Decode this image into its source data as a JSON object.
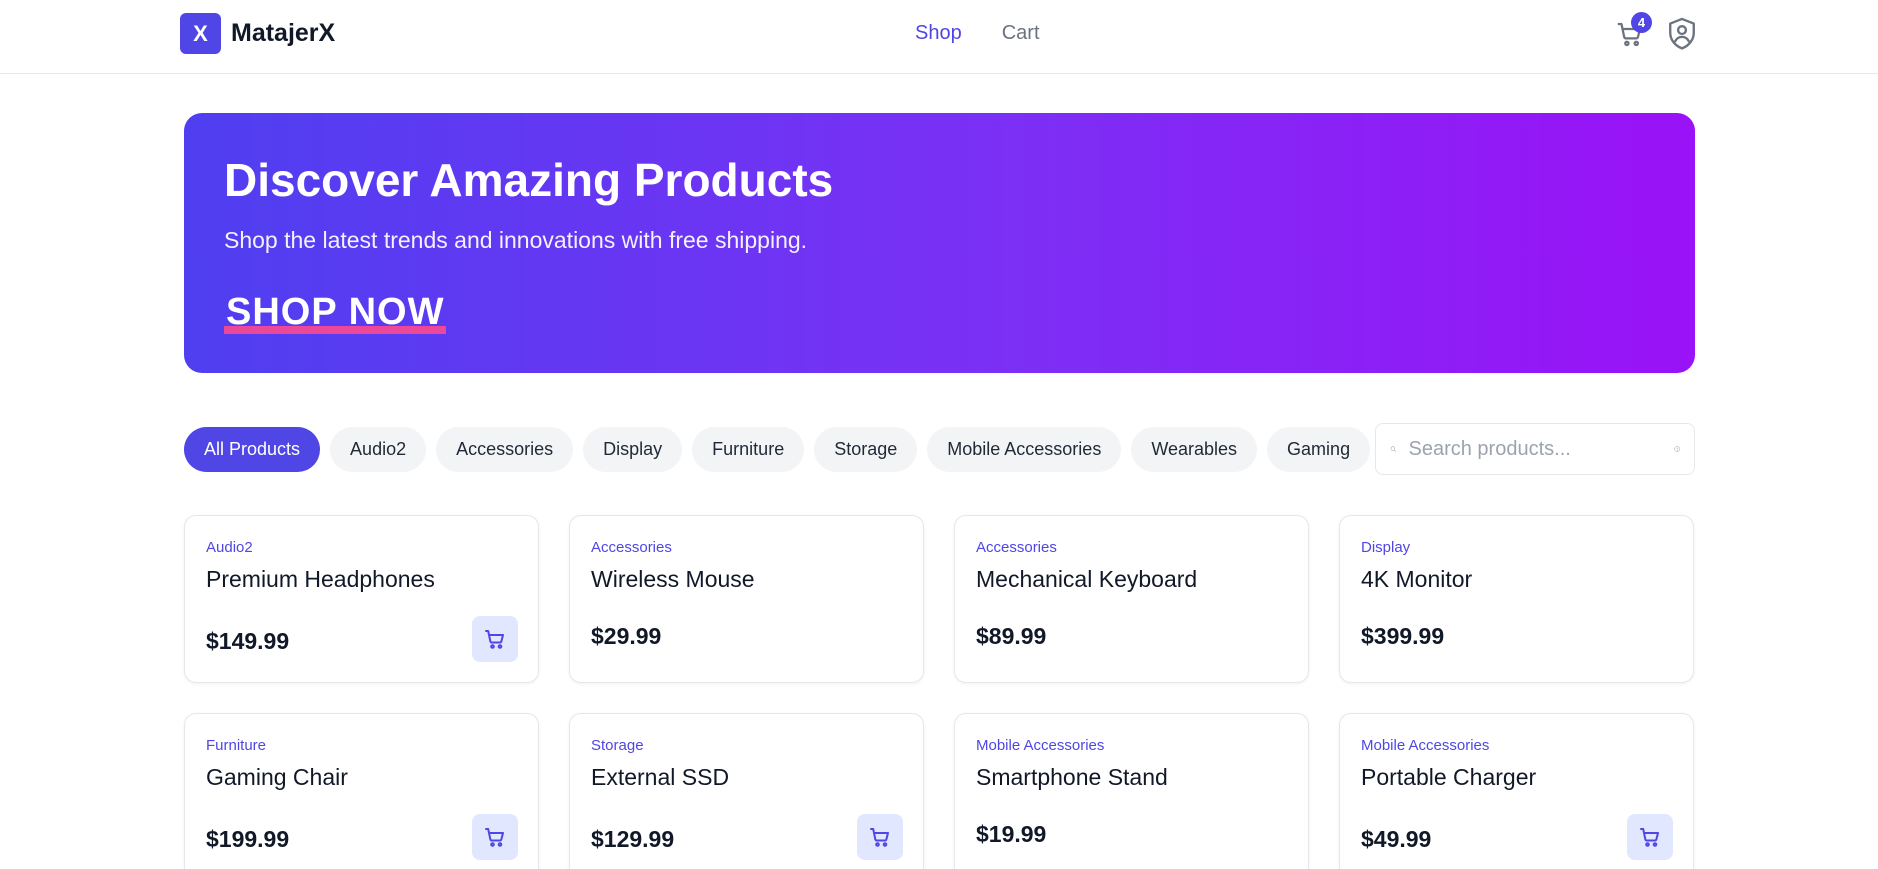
{
  "brand": {
    "logo_letter": "X",
    "name": "MatajerX"
  },
  "nav": {
    "shop": "Shop",
    "cart": "Cart"
  },
  "header": {
    "cart_count": "4"
  },
  "hero": {
    "title": "Discover Amazing Products",
    "subtitle": "Shop the latest trends and innovations with free shipping.",
    "cta": "SHOP NOW"
  },
  "filters": [
    "All Products",
    "Audio2",
    "Accessories",
    "Display",
    "Furniture",
    "Storage",
    "Mobile Accessories",
    "Wearables",
    "Gaming"
  ],
  "search": {
    "placeholder": "Search products..."
  },
  "products": [
    {
      "category": "Audio2",
      "name": "Premium Headphones",
      "price": "$149.99",
      "cart_button": true
    },
    {
      "category": "Accessories",
      "name": "Wireless Mouse",
      "price": "$29.99",
      "cart_button": false
    },
    {
      "category": "Accessories",
      "name": "Mechanical Keyboard",
      "price": "$89.99",
      "cart_button": false
    },
    {
      "category": "Display",
      "name": "4K Monitor",
      "price": "$399.99",
      "cart_button": false
    },
    {
      "category": "Furniture",
      "name": "Gaming Chair",
      "price": "$199.99",
      "cart_button": true
    },
    {
      "category": "Storage",
      "name": "External SSD",
      "price": "$129.99",
      "cart_button": true
    },
    {
      "category": "Mobile Accessories",
      "name": "Smartphone Stand",
      "price": "$19.99",
      "cart_button": false
    },
    {
      "category": "Mobile Accessories",
      "name": "Portable Charger",
      "price": "$49.99",
      "cart_button": true
    }
  ],
  "icons": {
    "search": "search-icon",
    "help": "help-circle-icon",
    "cart": "shopping-cart-icon",
    "account": "user-shield-icon"
  },
  "colors": {
    "accent": "#4f46e5",
    "hero_start": "#4f3ff0",
    "hero_end": "#9a12f7",
    "cta_underline": "#ec4899"
  }
}
